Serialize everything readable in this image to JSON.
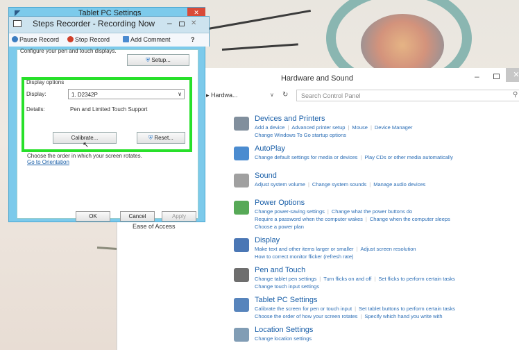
{
  "tablet_settings": {
    "title": "Tablet PC Settings",
    "close": "✕",
    "configure_text": "Configure your pen and touch displays.",
    "setup_label": "Setup...",
    "display_options_label": "Display options",
    "display_label": "Display:",
    "display_value": "1. D2342P",
    "details_label": "Details:",
    "details_value": "Pen and Limited Touch Support",
    "calibrate_label": "Calibrate...",
    "reset_label": "Reset...",
    "orientation_text": "Choose the order in which your screen rotates.",
    "orientation_link": "Go to Orientation",
    "ok_label": "OK",
    "cancel_label": "Cancel",
    "apply_label": "Apply"
  },
  "steps_recorder": {
    "title": "Steps Recorder - Recording Now",
    "pause_label": "Pause Record",
    "stop_label": "Stop Record",
    "comment_label": "Add Comment",
    "help_label": "?"
  },
  "control_panel": {
    "title": "Hardware and Sound",
    "breadcrumb": "▸ Hardwa...",
    "search_placeholder": "Search Control Panel",
    "ease_of_access": "Ease of Access",
    "categories": [
      {
        "title": "Devices and Printers",
        "lines": [
          [
            "Add a device",
            "Advanced printer setup",
            "Mouse",
            "Device Manager"
          ],
          [
            "Change Windows To Go startup options"
          ]
        ]
      },
      {
        "title": "AutoPlay",
        "lines": [
          [
            "Change default settings for media or devices",
            "Play CDs or other media automatically"
          ]
        ]
      },
      {
        "title": "Sound",
        "lines": [
          [
            "Adjust system volume",
            "Change system sounds",
            "Manage audio devices"
          ]
        ]
      },
      {
        "title": "Power Options",
        "lines": [
          [
            "Change power-saving settings",
            "Change what the power buttons do"
          ],
          [
            "Require a password when the computer wakes",
            "Change when the computer sleeps"
          ],
          [
            "Choose a power plan"
          ]
        ]
      },
      {
        "title": "Display",
        "lines": [
          [
            "Make text and other items larger or smaller",
            "Adjust screen resolution"
          ],
          [
            "How to correct monitor flicker (refresh rate)"
          ]
        ]
      },
      {
        "title": "Pen and Touch",
        "lines": [
          [
            "Change tablet pen settings",
            "Turn flicks on and off",
            "Set flicks to perform certain tasks"
          ],
          [
            "Change touch input settings"
          ]
        ]
      },
      {
        "title": "Tablet PC Settings",
        "lines": [
          [
            "Calibrate the screen for pen or touch input",
            "Set tablet buttons to perform certain tasks"
          ],
          [
            "Choose the order of how your screen rotates",
            "Specify which hand you write with"
          ]
        ]
      },
      {
        "title": "Location Settings",
        "lines": [
          [
            "Change location settings"
          ]
        ]
      }
    ]
  }
}
